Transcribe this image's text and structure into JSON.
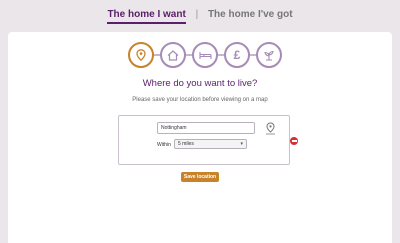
{
  "tabs": {
    "active": "The home I want",
    "separator": "|",
    "inactive": "The home I've got"
  },
  "steps": [
    {
      "icon": "location-pin-icon",
      "state": "active"
    },
    {
      "icon": "house-icon",
      "state": "inactive"
    },
    {
      "icon": "bed-icon",
      "state": "inactive"
    },
    {
      "icon": "pound-icon",
      "state": "inactive",
      "glyph": "£"
    },
    {
      "icon": "garden-icon",
      "state": "inactive"
    }
  ],
  "question": "Where do you want to live?",
  "hint": "Please save your location before viewing on a map",
  "location": {
    "value": "Nottingham",
    "within_label": "Within",
    "radius": "5 miles",
    "pin_icon": "map-pin-icon",
    "remove_icon": "remove-icon"
  },
  "save_label": "Save location",
  "colors": {
    "brand_purple": "#5a1e6b",
    "accent_orange": "#c8822a",
    "step_border": "#a58bb5",
    "remove_red": "#d63030",
    "background": "#eae6ea"
  }
}
